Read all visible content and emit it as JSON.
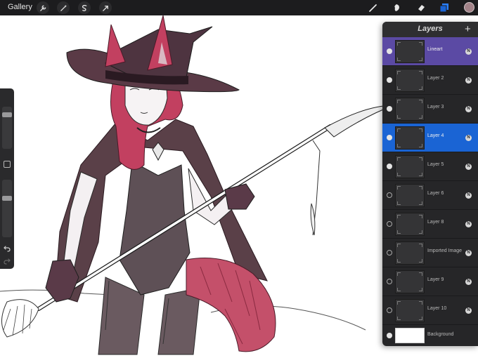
{
  "topbar": {
    "gallery_label": "Gallery",
    "adjust_icons": [
      "wrench-icon",
      "magic-wand-icon",
      "selection-icon",
      "transform-arrow-icon"
    ],
    "tool_icons": [
      "brush-icon",
      "smudge-icon",
      "eraser-icon",
      "layers-icon"
    ],
    "current_color": "#a28288",
    "accent": "#1a64d4"
  },
  "sidebar": {
    "brush_size_level": 0.15,
    "opacity_level": 0.3
  },
  "layers": {
    "title": "Layers",
    "add_label": "+",
    "items": [
      {
        "name": "Lineart",
        "visible": true,
        "blend": "N"
      },
      {
        "name": "Layer 2",
        "visible": true,
        "blend": "N"
      },
      {
        "name": "Layer 3",
        "visible": true,
        "blend": "N"
      },
      {
        "name": "Layer 4",
        "visible": true,
        "blend": "N"
      },
      {
        "name": "Layer 5",
        "visible": true,
        "blend": "N"
      },
      {
        "name": "Layer 6",
        "visible": false,
        "blend": "N"
      },
      {
        "name": "Layer 8",
        "visible": false,
        "blend": "N"
      },
      {
        "name": "Imported Image",
        "visible": false,
        "blend": "N"
      },
      {
        "name": "Layer 9",
        "visible": false,
        "blend": "N"
      },
      {
        "name": "Layer 10",
        "visible": false,
        "blend": "N"
      },
      {
        "name": "Background",
        "visible": true,
        "blend": ""
      }
    ]
  }
}
